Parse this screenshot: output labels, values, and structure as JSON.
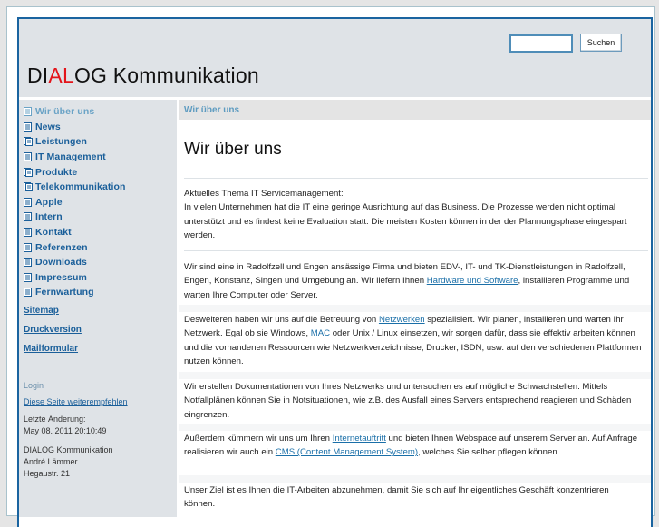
{
  "header": {
    "logo_parts": [
      "DI",
      "AL",
      "OG Kommunikation"
    ],
    "search_placeholder": "",
    "search_value": "",
    "search_button": "Suchen"
  },
  "colors": {
    "brand_blue": "#1a64a0",
    "logo_accent": "#e3141a",
    "link": "#1a6fa8",
    "nav_active": "#6aa3c6"
  },
  "sidebar": {
    "items": [
      {
        "label": "Wir über uns",
        "icon": "page-icon",
        "active": true
      },
      {
        "label": "News",
        "icon": "page-icon"
      },
      {
        "label": "Leistungen",
        "icon": "pages-stack-icon"
      },
      {
        "label": "IT Management",
        "icon": "page-icon"
      },
      {
        "label": "Produkte",
        "icon": "pages-stack-icon"
      },
      {
        "label": "Telekommunikation",
        "icon": "pages-stack-icon"
      },
      {
        "label": "Apple",
        "icon": "page-icon"
      },
      {
        "label": "Intern",
        "icon": "page-icon"
      },
      {
        "label": "Kontakt",
        "icon": "page-icon"
      },
      {
        "label": "Referenzen",
        "icon": "page-icon"
      },
      {
        "label": "Downloads",
        "icon": "page-icon"
      },
      {
        "label": "Impressum",
        "icon": "page-icon"
      },
      {
        "label": "Fernwartung",
        "icon": "page-icon"
      }
    ],
    "links": [
      "Sitemap",
      "Druckversion",
      "Mailformular"
    ],
    "login": "Login",
    "recommend": "Diese Seite weiterempfehlen",
    "last_change_label": "Letzte Änderung:",
    "last_change_value": "May 08. 2011 20:10:49",
    "address": [
      "DIALOG Kommunikation",
      "André Lämmer",
      "Hegaustr. 21"
    ]
  },
  "main": {
    "breadcrumb": "Wir über uns",
    "title": "Wir über uns",
    "intro_heading": "Aktuelles Thema IT Servicemanagement:",
    "intro_text": "In vielen Unternehmen  hat die IT eine geringe Ausrichtung auf das Business. Die Prozesse werden nicht optimal unterstützt und es findest keine Evaluation statt. Die meisten Kosten können in der der Plannungsphase eingespart werden.",
    "p1_before": "Wir sind eine in Radolfzell und Engen ansässige Firma und bieten EDV-, IT- und TK-Dienstleistungen in Radolfzell, Engen, Konstanz, Singen und Umgebung an. Wir liefern Ihnen ",
    "p1_link": "Hardware und Software",
    "p1_after": ", installieren Programme und warten Ihre Computer oder Server.",
    "p2_a": "Desweiteren haben wir uns auf die Betreuung von ",
    "p2_link1": "Netzwerken",
    "p2_b": " spezialisiert. Wir planen, installieren und warten Ihr Netzwerk. Egal ob sie Windows, ",
    "p2_link2": "MAC",
    "p2_c": " oder Unix / Linux einsetzen, wir sorgen dafür, dass sie effektiv arbeiten können und die vorhandenen Ressourcen wie Netzwerkverzeichnisse, Drucker, ISDN, usw. auf den verschiedenen Plattformen nutzen können.",
    "p3": "Wir erstellen Dokumentationen von Ihres Netzwerks und untersuchen es auf mögliche Schwachstellen. Mittels Notfallplänen können Sie in Notsituationen, wie z.B. des Ausfall eines Servers entsprechend reagieren und Schäden eingrenzen.",
    "p4_a": "Außerdem kümmern wir uns um Ihren ",
    "p4_link1": "Internetauftritt",
    "p4_b": " und bieten Ihnen Webspace auf unserem Server an. Auf Anfrage realisieren wir auch ein ",
    "p4_link2": "CMS (Content Management System)",
    "p4_c": ", welches Sie selber pflegen können.",
    "p5": "Unser Ziel ist es Ihnen die IT-Arbeiten abzunehmen, damit Sie sich auf Ihr eigentliches Geschäft konzentrieren können."
  }
}
